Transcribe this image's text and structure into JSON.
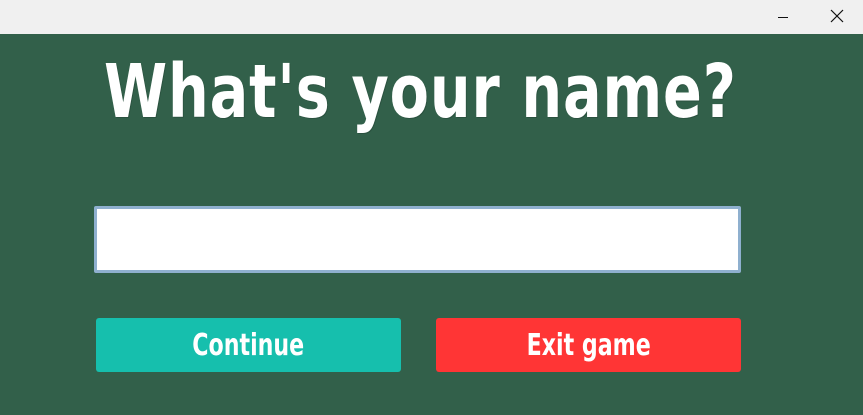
{
  "window": {
    "controls": [
      {
        "name": "minimize-icon"
      },
      {
        "name": "close-icon"
      }
    ]
  },
  "main": {
    "heading": "What's your name?",
    "name_input": {
      "value": "",
      "placeholder": ""
    },
    "continue_label": "Continue",
    "exit_label": "Exit game"
  },
  "colors": {
    "background": "#32604a",
    "continue_button": "#16bfad",
    "exit_button": "#ff3535",
    "input_border": "#8fb0cf"
  }
}
